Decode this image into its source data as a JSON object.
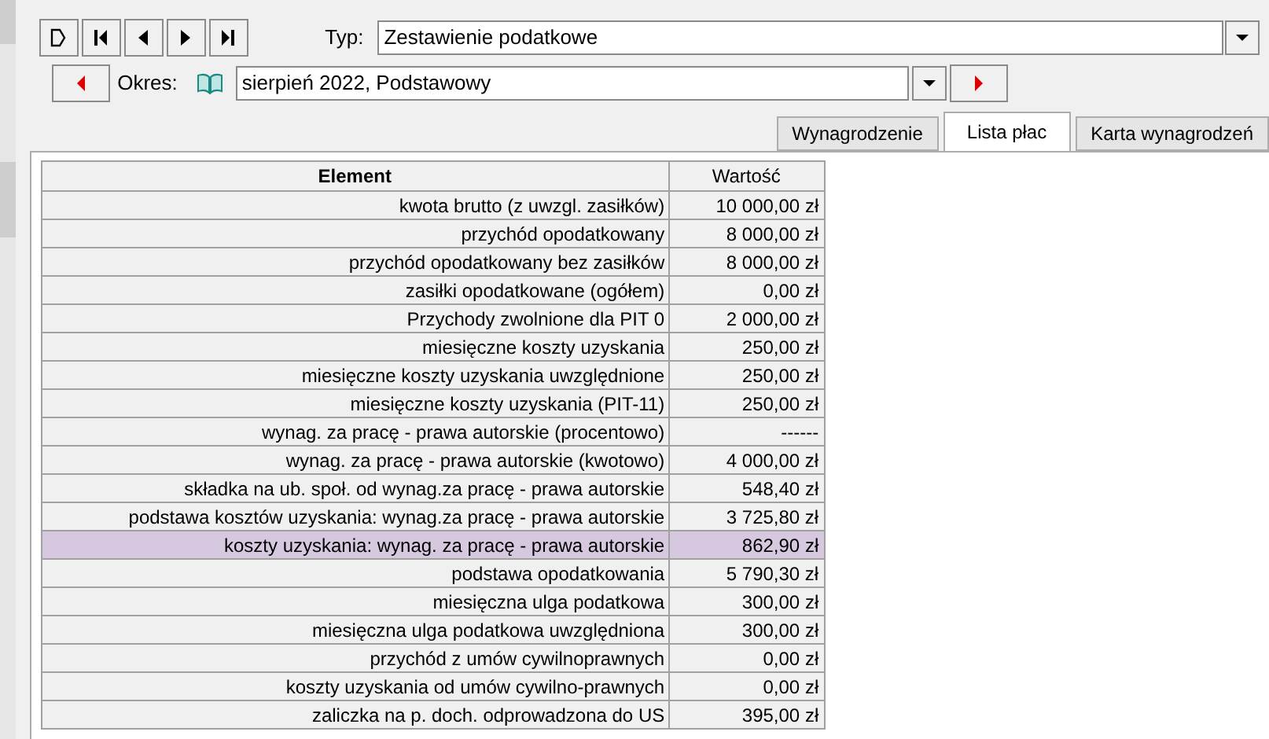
{
  "toolbar": {
    "nav_buttons": [
      {
        "kind": "new"
      },
      {
        "kind": "first"
      },
      {
        "kind": "prev"
      },
      {
        "kind": "next"
      },
      {
        "kind": "last"
      }
    ]
  },
  "type_field": {
    "label": "Typ:",
    "value": "Zestawienie podatkowe"
  },
  "period": {
    "label": "Okres:",
    "value": "sierpień 2022, Podstawowy"
  },
  "tabs": [
    {
      "label": "Wynagrodzenie",
      "selected": false
    },
    {
      "label": "Lista płac",
      "selected": true
    },
    {
      "label": "Karta wynagrodzeń",
      "selected": false
    }
  ],
  "table": {
    "columns": [
      "Element",
      "Wartość"
    ],
    "rows": [
      {
        "element": "kwota brutto (z uwzgl. zasiłków)",
        "value": "10 000,00 zł",
        "selected": false
      },
      {
        "element": "przychód opodatkowany",
        "value": "8 000,00 zł",
        "selected": false
      },
      {
        "element": "przychód opodatkowany bez zasiłków",
        "value": "8 000,00 zł",
        "selected": false
      },
      {
        "element": "zasiłki opodatkowane (ogółem)",
        "value": "0,00 zł",
        "selected": false
      },
      {
        "element": "Przychody zwolnione dla PIT 0",
        "value": "2 000,00 zł",
        "selected": false
      },
      {
        "element": "miesięczne koszty uzyskania",
        "value": "250,00 zł",
        "selected": false
      },
      {
        "element": "miesięczne koszty uzyskania uwzględnione",
        "value": "250,00 zł",
        "selected": false
      },
      {
        "element": "miesięczne koszty uzyskania (PIT-11)",
        "value": "250,00 zł",
        "selected": false
      },
      {
        "element": "wynag. za pracę - prawa autorskie (procentowo)",
        "value": "------",
        "selected": false
      },
      {
        "element": "wynag. za pracę - prawa autorskie (kwotowo)",
        "value": "4 000,00 zł",
        "selected": false
      },
      {
        "element": "składka na ub. społ. od wynag.za pracę - prawa autorskie",
        "value": "548,40 zł",
        "selected": false
      },
      {
        "element": "podstawa kosztów uzyskania: wynag.za pracę - prawa autorskie",
        "value": "3 725,80 zł",
        "selected": false
      },
      {
        "element": "koszty uzyskania: wynag. za pracę - prawa autorskie",
        "value": "862,90 zł",
        "selected": true
      },
      {
        "element": "podstawa opodatkowania",
        "value": "5 790,30 zł",
        "selected": false
      },
      {
        "element": "miesięczna ulga podatkowa",
        "value": "300,00 zł",
        "selected": false
      },
      {
        "element": "miesięczna ulga podatkowa uwzględniona",
        "value": "300,00 zł",
        "selected": false
      },
      {
        "element": "przychód z umów cywilnoprawnych",
        "value": "0,00 zł",
        "selected": false
      },
      {
        "element": "koszty uzyskania od umów cywilno-prawnych",
        "value": "0,00 zł",
        "selected": false
      },
      {
        "element": "zaliczka na p. doch. odprowadzona do US",
        "value": "395,00 zł",
        "selected": false
      }
    ]
  }
}
